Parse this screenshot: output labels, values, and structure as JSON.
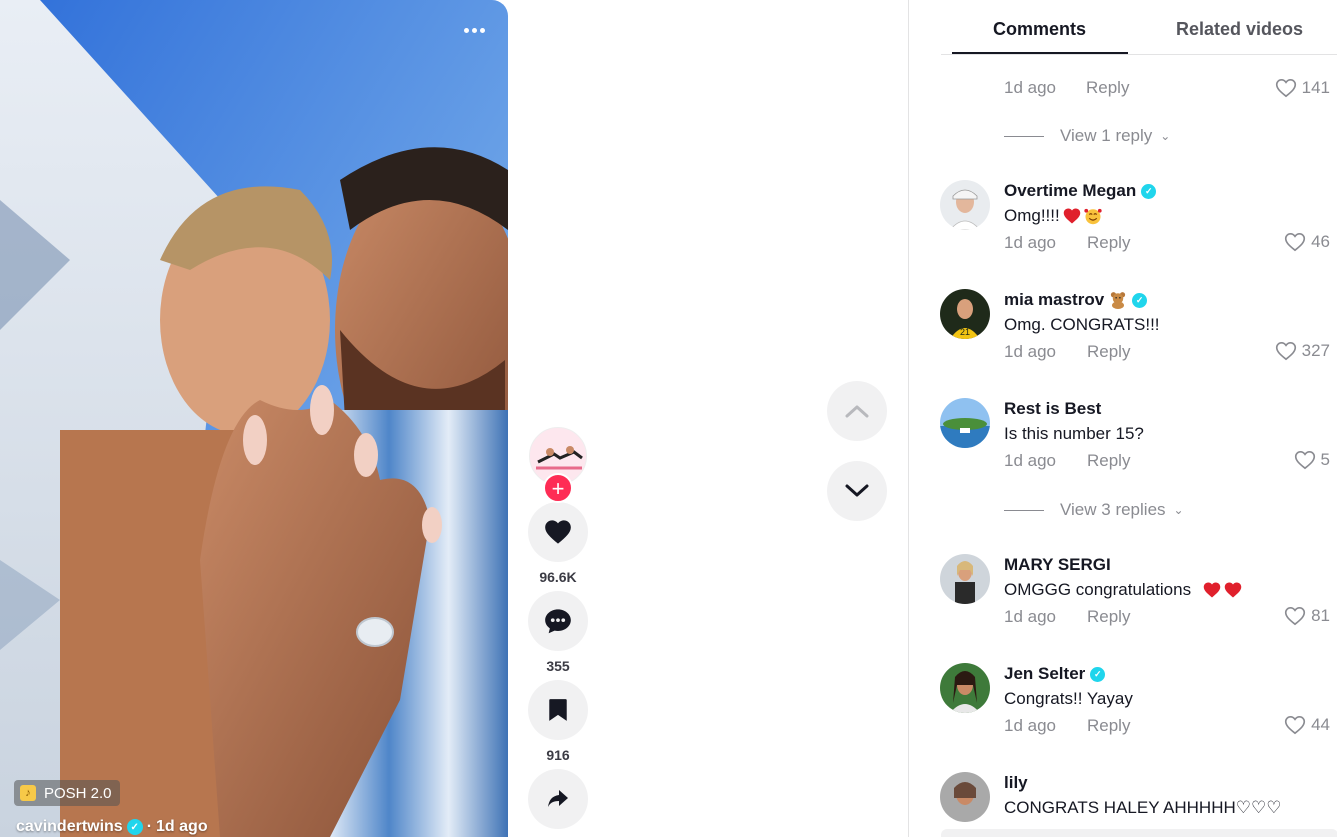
{
  "video": {
    "music_label": "POSH 2.0",
    "author": "cavindertwins",
    "date_separator": "·",
    "date": "1d ago"
  },
  "actions": {
    "likes": "96.6K",
    "comments": "355",
    "saves": "916"
  },
  "tabs": {
    "comments": "Comments",
    "related": "Related videos"
  },
  "top_partial": {
    "date": "1d ago",
    "reply": "Reply",
    "likes": "141",
    "view_replies": "View 1 reply"
  },
  "comments": [
    {
      "user": "Overtime Megan",
      "verified": true,
      "text": "Omg!!!!",
      "emoji": [
        "red-heart",
        "smiling-face-with-hearts"
      ],
      "date": "1d ago",
      "reply": "Reply",
      "likes": "46"
    },
    {
      "user": "mia mastrov",
      "verified": true,
      "name_emoji": "teddy-bear",
      "text": "Omg. CONGRATS!!!",
      "date": "1d ago",
      "reply": "Reply",
      "likes": "327"
    },
    {
      "user": "Rest is Best",
      "verified": false,
      "text": "Is this number 15?",
      "date": "1d ago",
      "reply": "Reply",
      "likes": "5",
      "view_replies": "View 3 replies"
    },
    {
      "user": "MARY SERGI",
      "verified": false,
      "text": "OMGGG congratulations",
      "emoji": [
        "red-heart",
        "red-heart"
      ],
      "date": "1d ago",
      "reply": "Reply",
      "likes": "81"
    },
    {
      "user": "Jen Selter",
      "verified": true,
      "text": "Congrats!! Yayay",
      "date": "1d ago",
      "reply": "Reply",
      "likes": "44"
    },
    {
      "user": "lily",
      "verified": false,
      "text": "CONGRATS HALEY AHHHHH♡♡♡"
    }
  ],
  "colors": {
    "accent_red": "#fe2c55",
    "verified_blue": "#20d5ec",
    "text_primary": "#161823",
    "text_secondary": "#8a8b91",
    "button_bg": "#f1f1f2"
  }
}
